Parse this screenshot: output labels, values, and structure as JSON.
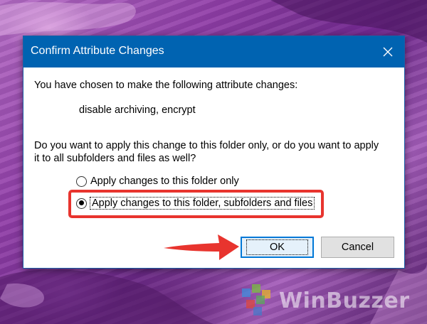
{
  "dialog": {
    "title": "Confirm Attribute Changes",
    "close_icon": "close-icon",
    "message": "You have chosen to make the following attribute changes:",
    "changes": "disable archiving, encrypt",
    "question_line1": "Do you want to apply this change to this folder only, or do you want to apply",
    "question_line2": "it to all subfolders and files as well?",
    "options": [
      {
        "label": "Apply changes to this folder only",
        "selected": false
      },
      {
        "label": "Apply changes to this folder, subfolders and files",
        "selected": true
      }
    ],
    "ok_label": "OK",
    "cancel_label": "Cancel"
  },
  "annotation": {
    "highlight_color": "#e8342e",
    "arrow_color": "#e8342e"
  },
  "watermark": {
    "text": "WinBuzzer",
    "logo_icon": "winbuzzer-logo-icon"
  },
  "colors": {
    "titlebar": "#0063b1",
    "default_button_border": "#0078d7"
  }
}
